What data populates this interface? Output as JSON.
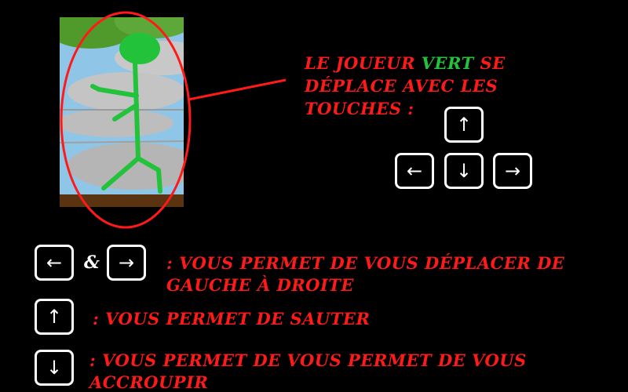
{
  "intro": {
    "line1_before": "LE JOUEUR ",
    "player_color_word": "VERT",
    "line1_after": " SE",
    "line2": "DÉPLACE AVEC LES",
    "line3": "TOUCHES :"
  },
  "colors": {
    "text_red": "#ff1a1a",
    "player_green": "#22c33a",
    "background": "#000000",
    "key_border": "#ffffff"
  },
  "arrow_keys": {
    "up": "↑",
    "left": "←",
    "down": "↓",
    "right": "→"
  },
  "controls": {
    "move": {
      "left_key": "←",
      "joiner": "&",
      "right_key": "→",
      "line1": ": VOUS PERMET DE VOUS DÉPLACER DE",
      "line2": "GAUCHE À DROITE"
    },
    "jump": {
      "key": "↑",
      "line1": ": VOUS PERMET DE SAUTER"
    },
    "crouch": {
      "key": "↓",
      "line1": ": VOUS PERMET DE VOUS PERMET DE VOUS",
      "line2": "ACCROUPIR"
    }
  },
  "icons": {
    "player": "green-stick-figure-icon",
    "highlight": "red-ellipse-highlight"
  }
}
